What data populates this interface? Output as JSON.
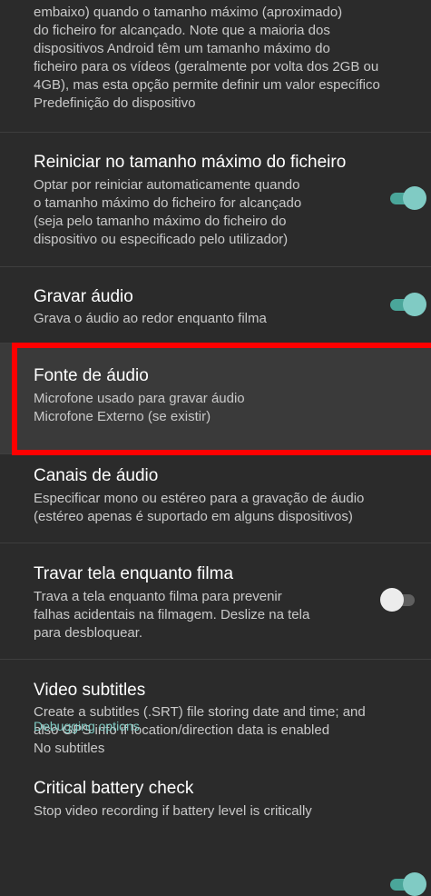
{
  "top_partial": {
    "summary": "embaixo) quando o tamanho máximo (aproximado)\ndo ficheiro for alcançado. Note que a maioria dos\ndispositivos Android têm um tamanho máximo do\nficheiro para os vídeos (geralmente por volta dos 2GB ou\n4GB), mas esta opção permite definir um valor específico",
    "value": "Predefinição do dispositivo"
  },
  "restart_max_size": {
    "title": "Reiniciar no tamanho máximo do ficheiro",
    "summary": "Optar por reiniciar automaticamente quando\no tamanho máximo do ficheiro for alcançado\n(seja pelo tamanho máximo do ficheiro do\ndispositivo ou especificado pelo utilizador)",
    "enabled": true
  },
  "record_audio": {
    "title": "Gravar áudio",
    "summary": "Grava o áudio ao redor enquanto filma",
    "enabled": true
  },
  "audio_source": {
    "title": "Fonte de áudio",
    "summary": "Microfone usado para gravar áudio",
    "value": "Microfone Externo (se existir)"
  },
  "audio_channels": {
    "title": "Canais de áudio",
    "summary": "Especificar mono ou estéreo para a gravação de áudio\n(estéreo apenas é suportado em alguns dispositivos)"
  },
  "lock_screen": {
    "title": "Travar tela enquanto filma",
    "summary": "Trava a tela enquanto filma para prevenir\nfalhas acidentais na filmagem. Deslize na tela\npara desbloquear.",
    "enabled": false
  },
  "video_subtitles": {
    "title": "Video subtitles",
    "summary": "Create a subtitles (.SRT) file storing date and time; and\nalso GPS info if location/direction data is enabled",
    "value": "No subtitles"
  },
  "debugging": {
    "category": "Debugging options"
  },
  "battery_check": {
    "title": "Critical battery check",
    "summary": "Stop video recording if battery level is critically",
    "enabled": true
  },
  "colors": {
    "background": "#2b2b2b",
    "accent": "#80cbc4",
    "highlight_box": "#ff0000"
  }
}
